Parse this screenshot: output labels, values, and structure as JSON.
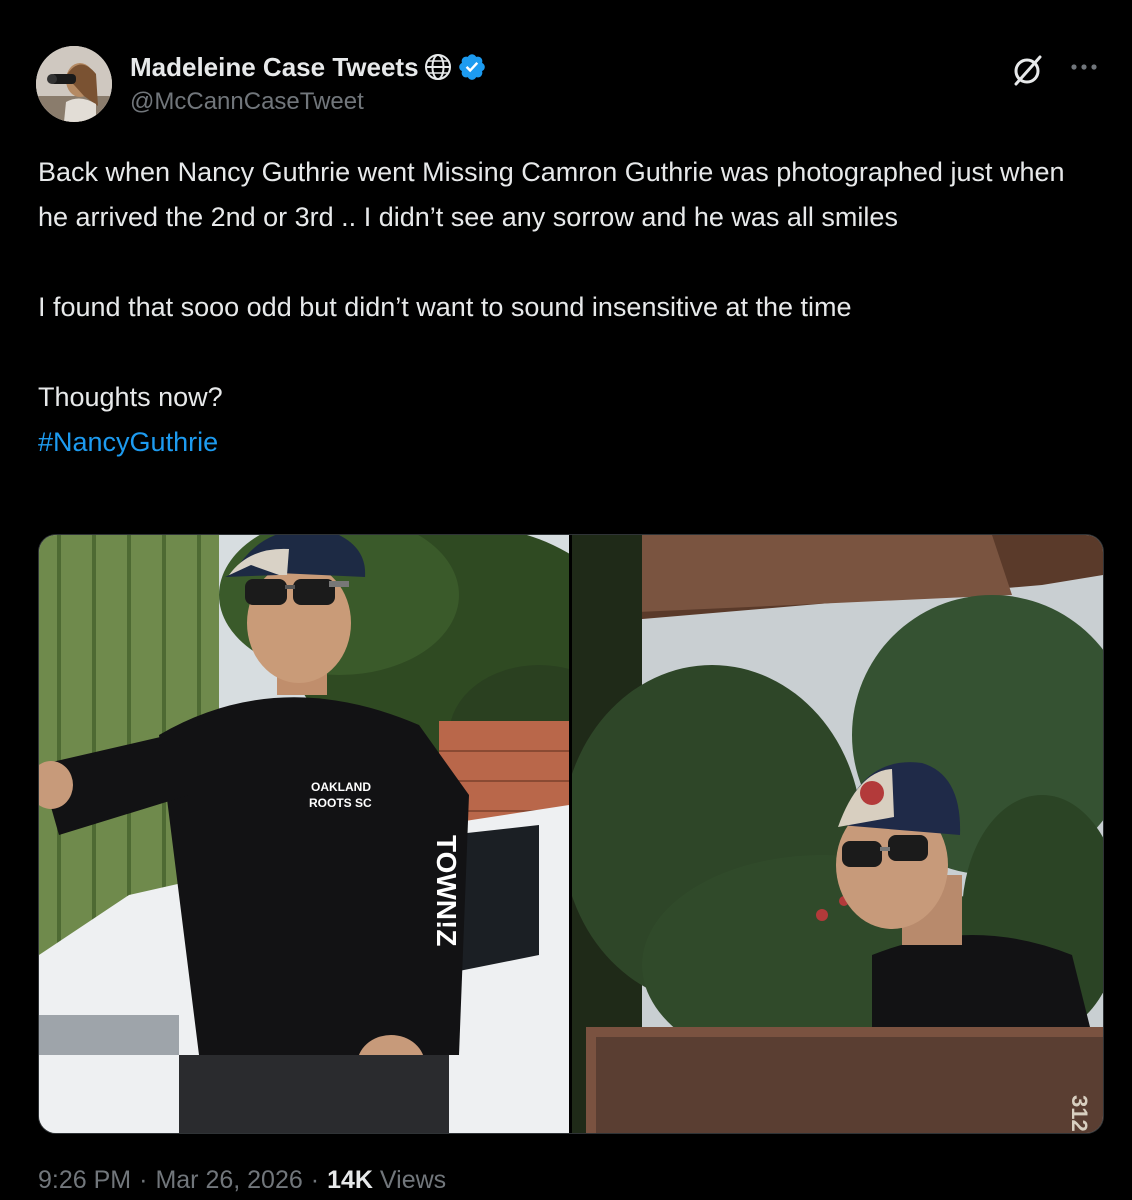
{
  "author": {
    "display_name": "Madeleine Case Tweets",
    "handle": "@McCannCaseTweet",
    "verified": true,
    "badge_icons": [
      "globe-icon",
      "verified-icon"
    ]
  },
  "actions": {
    "grok_icon": "grok-icon",
    "more_icon": "more-icon"
  },
  "tweet": {
    "line1": "Back when Nancy Guthrie went Missing Camron Guthrie was photographed just when he arrived the 2nd or 3rd .. I didn’t see any sorrow and he was all smiles",
    "line2": "I found that sooo odd but didn’t want to sound insensitive at the time",
    "line3": "Thoughts now?",
    "hashtag": "#NancyGuthrie"
  },
  "media": {
    "left_photo": {
      "shirt_text_line1": "OAKLAND",
      "shirt_text_line2": "ROOTS SC",
      "sleeve_text": "TOWN!Z"
    },
    "right_photo": {
      "sign_text": "312"
    }
  },
  "meta": {
    "time": "9:26 PM",
    "separator": "·",
    "date": "Mar 26, 2026",
    "views_count": "14K",
    "views_label": "Views"
  },
  "colors": {
    "background": "#000000",
    "text": "#e7e9ea",
    "secondary": "#71767b",
    "accent": "#1d9bf0"
  }
}
